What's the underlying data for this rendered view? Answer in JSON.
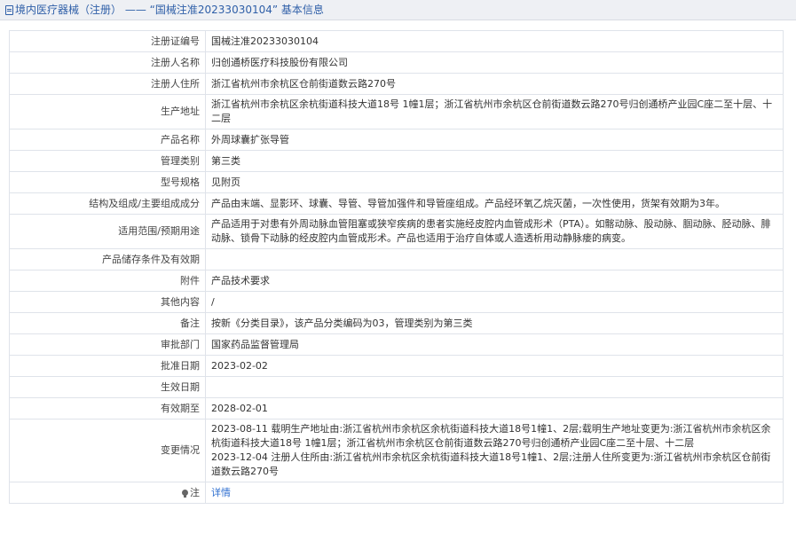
{
  "header": {
    "breadcrumb": "境内医疗器械（注册）",
    "separator": "——",
    "record_title": "“国械注准20233030104”",
    "suffix": "基本信息"
  },
  "rows": [
    {
      "label": "注册证编号",
      "value": "国械注准20233030104"
    },
    {
      "label": "注册人名称",
      "value": "归创通桥医疗科技股份有限公司"
    },
    {
      "label": "注册人住所",
      "value": "浙江省杭州市余杭区仓前街道数云路270号"
    },
    {
      "label": "生产地址",
      "value": "浙江省杭州市余杭区余杭街道科技大道18号 1幢1层；浙江省杭州市余杭区仓前街道数云路270号归创通桥产业园C座二至十层、十二层"
    },
    {
      "label": "产品名称",
      "value": "外周球囊扩张导管"
    },
    {
      "label": "管理类别",
      "value": "第三类"
    },
    {
      "label": "型号规格",
      "value": "见附页"
    },
    {
      "label": "结构及组成/主要组成成分",
      "value": "产品由末端、显影环、球囊、导管、导管加强件和导管座组成。产品经环氧乙烷灭菌，一次性使用，货架有效期为3年。"
    },
    {
      "label": "适用范围/预期用途",
      "value": "产品适用于对患有外周动脉血管阻塞或狭窄疾病的患者实施经皮腔内血管成形术（PTA）。如髂动脉、股动脉、腘动脉、胫动脉、腓动脉、锁骨下动脉的经皮腔内血管成形术。产品也适用于治疗自体或人造透析用动静脉瘘的病变。"
    },
    {
      "label": "产品储存条件及有效期",
      "value": ""
    },
    {
      "label": "附件",
      "value": "产品技术要求"
    },
    {
      "label": "其他内容",
      "value": "/"
    },
    {
      "label": "备注",
      "value": "按新《分类目录》，该产品分类编码为03，管理类别为第三类"
    },
    {
      "label": "审批部门",
      "value": "国家药品监督管理局"
    },
    {
      "label": "批准日期",
      "value": "2023-02-02"
    },
    {
      "label": "生效日期",
      "value": ""
    },
    {
      "label": "有效期至",
      "value": "2028-02-01"
    }
  ],
  "changes": {
    "label": "变更情况",
    "lines": [
      "2023-08-11 载明生产地址由:浙江省杭州市余杭区余杭街道科技大道18号1幢1、2层;载明生产地址变更为:浙江省杭州市余杭区余杭街道科技大道18号 1幢1层；浙江省杭州市余杭区仓前街道数云路270号归创通桥产业园C座二至十层、十二层",
      "2023-12-04 注册人住所由:浙江省杭州市余杭区余杭街道科技大道18号1幢1、2层;注册人住所变更为:浙江省杭州市余杭区仓前街道数云路270号"
    ]
  },
  "note": {
    "label": "注",
    "icon": "bulb-icon",
    "link": "详情"
  }
}
